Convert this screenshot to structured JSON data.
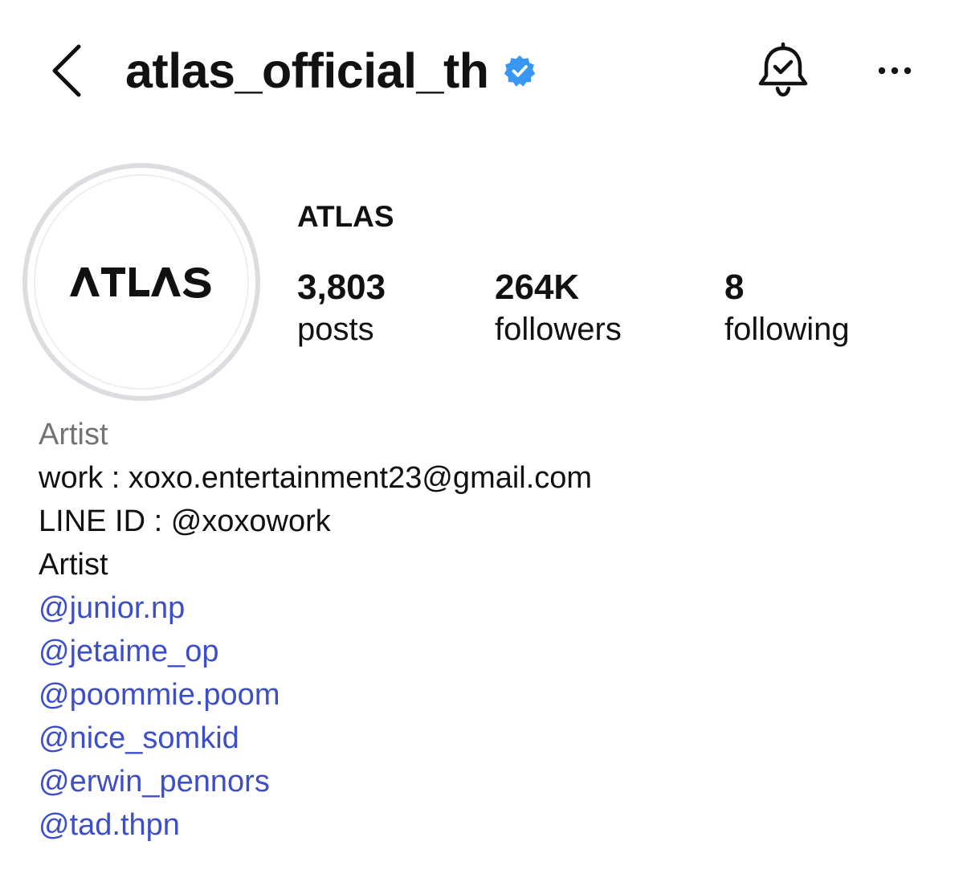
{
  "header": {
    "back_icon": "chevron-left-icon",
    "username": "atlas_official_th",
    "verified_icon": "verified-badge-icon",
    "verified_color": "#3897f0",
    "notification_icon": "bell-check-icon",
    "more_icon": "more-horizontal-icon"
  },
  "profile": {
    "avatar_text": "ATLAS",
    "avatar_ring_color": "#dcdde1",
    "display_name": "ATLAS",
    "stats": {
      "posts": {
        "value": "3,803",
        "label": "posts"
      },
      "followers": {
        "value": "264K",
        "label": "followers"
      },
      "following": {
        "value": "8",
        "label": "following"
      }
    }
  },
  "bio": {
    "category": "Artist",
    "lines": [
      "work : xoxo.entertainment23@gmail.com",
      "LINE ID : @xoxowork",
      "Artist"
    ],
    "mentions": [
      "@junior.np",
      "@jetaime_op",
      "@poommie.poom",
      "@nice_somkid",
      "@erwin_pennors",
      "@tad.thpn"
    ],
    "mention_color": "#3d4fc8"
  }
}
